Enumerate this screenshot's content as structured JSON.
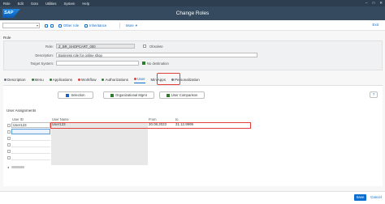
{
  "menu": [
    "Role",
    "Edit",
    "Goto",
    "Utilities",
    "System",
    "Help"
  ],
  "window_controls": [
    "–",
    "□",
    "✕"
  ],
  "brand": "SAP",
  "shell": {
    "title": "Change Roles"
  },
  "toolbar": {
    "other_role": "Other role",
    "inheritance": "Inheritance",
    "more": "More",
    "exit": "Exit"
  },
  "role": {
    "section_title": "Role",
    "role_label": "Role:",
    "role_value": "Z_BR_SHOPCART_000",
    "obsolete_label": "Obsolete",
    "description_label": "Description:",
    "description_value": "Business role for online shop",
    "target_label": "Target System:",
    "target_value": "",
    "no_destination": "No destination"
  },
  "tabs": [
    {
      "label": "Description",
      "color": "#6a7a8c"
    },
    {
      "label": "Menu",
      "color": "#2b7d2b"
    },
    {
      "label": "Applications",
      "color": "#2b7d2b"
    },
    {
      "label": "Workflow",
      "color": "#e0403d"
    },
    {
      "label": "Authorizations",
      "color": "#2b7d2b"
    },
    {
      "label": "User",
      "color": "#e0403d"
    },
    {
      "label": "MiniApps",
      "color": ""
    },
    {
      "label": "Personalization",
      "color": "#6a7a8c"
    }
  ],
  "buttons": {
    "selection": "Selection",
    "org_mgmt": "Organizational Mgmt",
    "user_comparison": "User Comparison",
    "help": "?"
  },
  "user_assignments": {
    "title": "User Assignments",
    "columns": [
      "User ID",
      "User Name",
      "From",
      "to"
    ],
    "rows": [
      {
        "user_id": "User123",
        "user_name": "User123",
        "from": "30.08.2023",
        "to": "31.12.9999"
      }
    ]
  },
  "footer": {
    "save": "Save",
    "cancel": "Cancel"
  }
}
